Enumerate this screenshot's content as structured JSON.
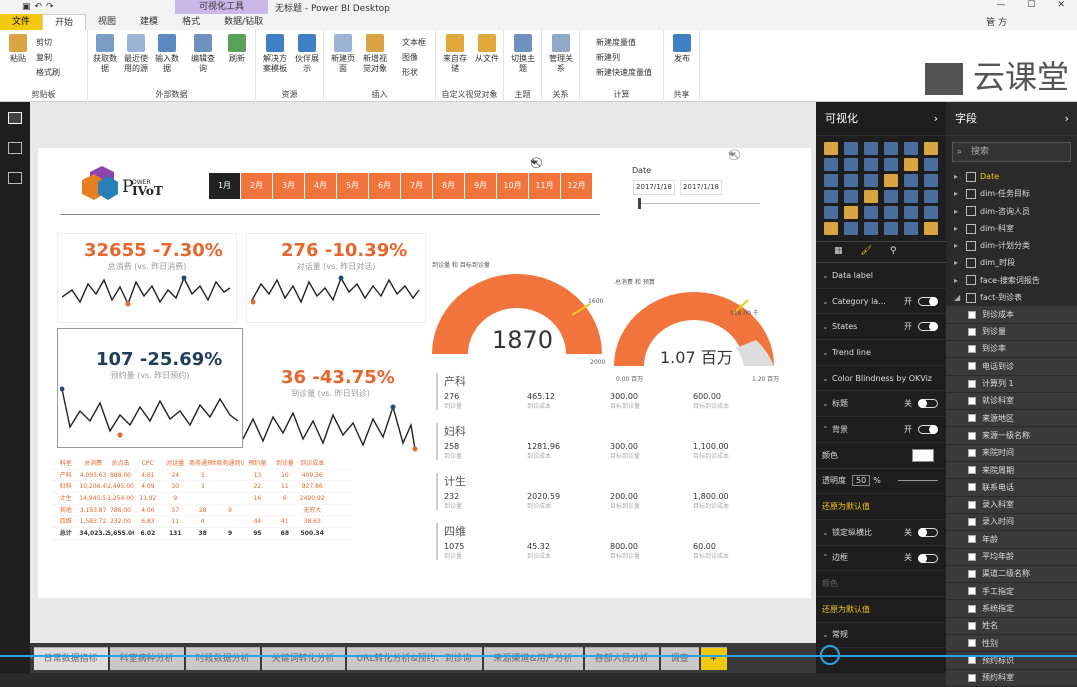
{
  "window": {
    "title": "无标题 - Power BI Desktop",
    "context_tab": "可视化工具",
    "user": "管 方"
  },
  "menu": [
    "文件",
    "开始",
    "视图",
    "建模",
    "格式",
    "数据/钻取"
  ],
  "ribbon": {
    "clipboard": {
      "paste": "粘贴",
      "cut": "剪切",
      "copy": "复制",
      "format_painter": "格式刷",
      "label": "剪贴板"
    },
    "external": {
      "get_data": "获取数据",
      "recent": "最近使用的源",
      "enter": "输入数据",
      "edit": "编辑查询",
      "refresh": "刷新",
      "label": "外部数据"
    },
    "resources": {
      "templates": "解决方案模板",
      "partner": "伙伴展示",
      "label": "资源"
    },
    "insert": {
      "new_page": "新建页面",
      "new_visual": "新增视觉对象",
      "textbox": "文本框",
      "image": "图像",
      "shapes": "形状",
      "label": "插入"
    },
    "custom": {
      "from_store": "来自存储",
      "from_file": "从文件",
      "label": "自定义视觉对象"
    },
    "themes": {
      "switch": "切换主题",
      "label": "主题"
    },
    "relations": {
      "manage": "管理关系",
      "label": "关系"
    },
    "calc": {
      "measure": "新建度量值",
      "column": "新建列",
      "quick": "新建快速度量值",
      "label": "计算"
    },
    "share": {
      "publish": "发布",
      "label": "共享"
    }
  },
  "watermark": "云课堂",
  "months": [
    "1月",
    "2月",
    "3月",
    "4月",
    "5月",
    "6月",
    "7月",
    "8月",
    "9月",
    "10月",
    "11月",
    "12月"
  ],
  "date_slicer": {
    "title": "Date",
    "from": "2017/1/18",
    "to": "2017/1/18"
  },
  "kpis": [
    {
      "value": "32655",
      "change": "-7.30%",
      "label": "总消费 (vs. 昨日消费)"
    },
    {
      "value": "276",
      "change": "-10.39%",
      "label": "对话量 (vs. 昨日对话)"
    },
    {
      "value": "107",
      "change": "-25.69%",
      "label": "预约量 (vs. 昨日预约)"
    },
    {
      "value": "36",
      "change": "-43.75%",
      "label": "到诊量 (vs. 昨日到诊)"
    }
  ],
  "gauges": [
    {
      "title": "到诊量 和 目标到诊量",
      "value": "1870",
      "target": "1600",
      "max": "2000"
    },
    {
      "title": "总消费 和 预算",
      "value": "1.07 百万",
      "target": "918.00 千",
      "min": "0.00 百万",
      "max": "1.20 百万"
    }
  ],
  "table": {
    "headers": [
      "科室",
      "总消费",
      "总点击",
      "CPC",
      "对话量",
      "商务通预约",
      "商务通到诊",
      "预约量",
      "到诊量",
      "到诊成本"
    ],
    "rows": [
      [
        "产科",
        "4,093.63",
        "888.00",
        "4.61",
        "24",
        "3",
        "",
        "13",
        "10",
        "409.36"
      ],
      [
        "妇科",
        "10,206.48",
        "2,495.00",
        "4.09",
        "30",
        "3",
        "",
        "22",
        "11",
        "927.86"
      ],
      [
        "计生",
        "14,945.54",
        "1,254.00",
        "11.92",
        "9",
        "",
        "",
        "16",
        "6",
        "2490.92"
      ],
      [
        "其他",
        "3,193.87",
        "786.00",
        "4.06",
        "57",
        "28",
        "9",
        "",
        "",
        "无穷大"
      ],
      [
        "四维",
        "1,583.72",
        "232.00",
        "6.83",
        "11",
        "4",
        "",
        "44",
        "41",
        "38.63"
      ]
    ],
    "total": [
      "总计",
      "34,023.24",
      "5,655.00",
      "6.02",
      "131",
      "38",
      "9",
      "95",
      "68",
      "500.34"
    ]
  },
  "depts": [
    {
      "name": "产科",
      "v1": "276",
      "v2": "465.12",
      "v3": "300.00",
      "v4": "600.00"
    },
    {
      "name": "妇科",
      "v1": "258",
      "v2": "1281.96",
      "v3": "300.00",
      "v4": "1,100.00"
    },
    {
      "name": "计生",
      "v1": "232",
      "v2": "2020.59",
      "v3": "200.00",
      "v4": "1,800.00"
    },
    {
      "name": "四维",
      "v1": "1075",
      "v2": "45.32",
      "v3": "800.00",
      "v4": "60.00"
    }
  ],
  "dept_labels": [
    "到诊量",
    "到诊成本",
    "目标到诊量",
    "目标到诊成本"
  ],
  "viz_pane": {
    "title": "可视化",
    "format_rows": [
      {
        "label": "Data label",
        "toggle": ""
      },
      {
        "label": "Category la...",
        "toggle": "开"
      },
      {
        "label": "States",
        "toggle": "开"
      },
      {
        "label": "Trend line",
        "toggle": ""
      },
      {
        "label": "Color Blindness by OKViz",
        "toggle": ""
      },
      {
        "label": "标题",
        "toggle": "关"
      },
      {
        "label": "背景",
        "toggle": "开"
      }
    ],
    "color_label": "颜色",
    "transparency_label": "透明度",
    "transparency": "50",
    "reset": "还原为默认值",
    "lock_aspect": "锁定纵横比",
    "lock_toggle": "关",
    "border": "边框",
    "border_toggle": "关",
    "border_color": "颜色",
    "general": "常规"
  },
  "fields_pane": {
    "title": "字段",
    "search": "搜索",
    "tables": [
      "Date",
      "dim-任务目标",
      "dim-咨询人员",
      "dim-科室",
      "dim-计划分类",
      "dim_时段",
      "face-搜索词报告",
      "fact-到诊表"
    ],
    "fields": [
      "到诊成本",
      "到诊量",
      "到诊率",
      "电话到诊",
      "计算列 1",
      "就诊科室",
      "来源地区",
      "来源一级名称",
      "来院时间",
      "来院周期",
      "联系电话",
      "录入科室",
      "录入时间",
      "年龄",
      "平均年龄",
      "渠道二级名称",
      "手工指定",
      "系统指定",
      "姓名",
      "性别",
      "预约标识",
      "预约科室"
    ]
  },
  "pages": [
    "日常数据指标",
    "科室病种分析",
    "时段数据分析",
    "关键词转化分析",
    "URL转化分析&预约、到诊询",
    "来源渠道&用户分析",
    "各部人员分析",
    "调查"
  ]
}
